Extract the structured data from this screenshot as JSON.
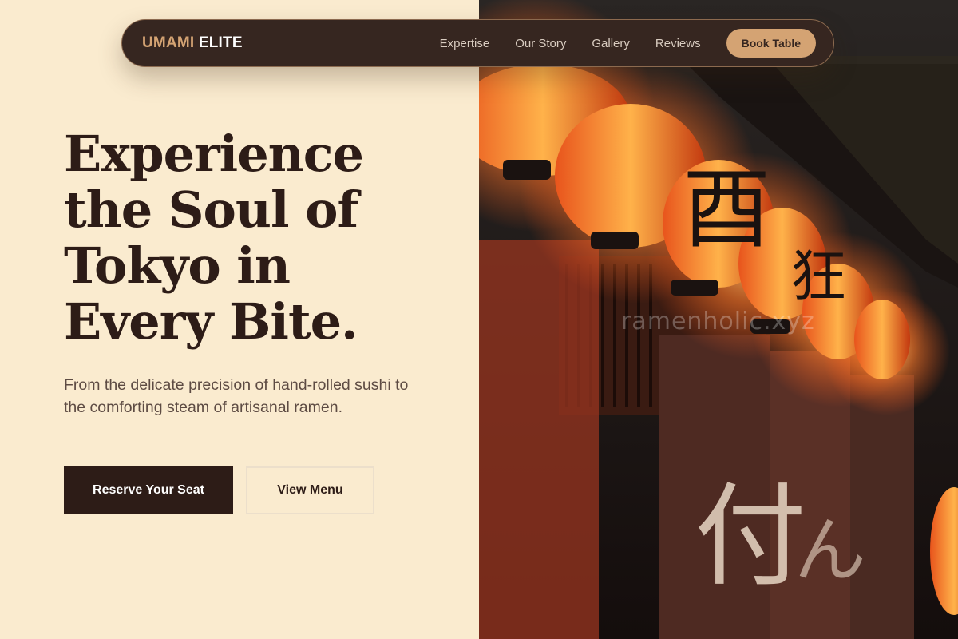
{
  "brand": {
    "part1": "UMAMI",
    "part2": "ELITE"
  },
  "nav": {
    "links": [
      {
        "label": "Expertise"
      },
      {
        "label": "Our Story"
      },
      {
        "label": "Gallery"
      },
      {
        "label": "Reviews"
      }
    ],
    "cta": "Book Table"
  },
  "hero": {
    "title_lines": [
      "Experience",
      "the Soul of",
      "Tokyo in",
      "Every Bite."
    ],
    "subtitle": "From the delicate precision of hand-rolled sushi to the comforting steam of artisanal ramen.",
    "primary_button": "Reserve Your Seat",
    "secondary_button": "View Menu"
  },
  "image": {
    "watermark": "ramenholic.xyz"
  },
  "colors": {
    "background": "#faebcf",
    "dark_brown": "#2d1c17",
    "nav_bg": "#362620",
    "accent": "#d4a373",
    "body_text": "#5d4b43"
  }
}
